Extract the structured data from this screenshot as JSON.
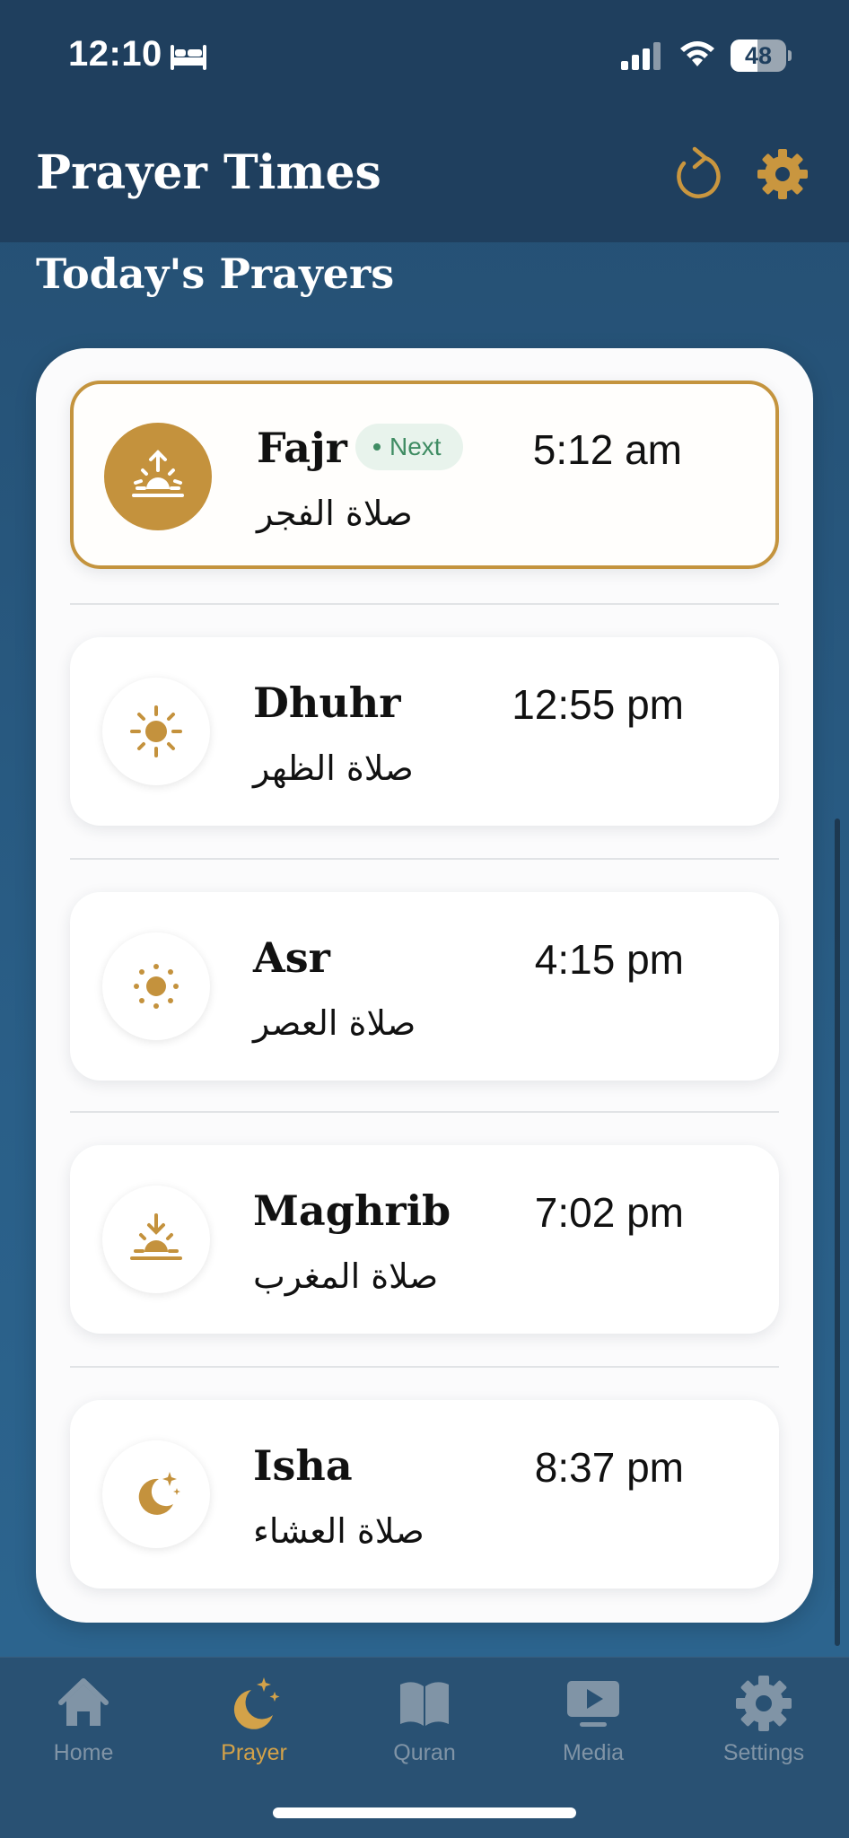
{
  "status_bar": {
    "time": "12:10",
    "battery": "48",
    "battery_level": 0.48,
    "icons": [
      "bed-icon",
      "signal-icon",
      "wifi-icon",
      "battery-icon"
    ]
  },
  "header": {
    "title": "Prayer Times",
    "refresh_icon": "refresh-icon",
    "settings_icon": "gear-icon"
  },
  "section_title": "Today's Prayers",
  "colors": {
    "accent_gold": "#c4923d",
    "header_navy": "#1f3f5e",
    "next_green": "#3f8c63",
    "tab_inactive": "#8094a6"
  },
  "prayers": [
    {
      "name": "Fajr",
      "arabic": "صلاة الفجر",
      "time": "5:12 am",
      "badge": "Next",
      "icon": "sunrise-icon",
      "is_next": true
    },
    {
      "name": "Dhuhr",
      "arabic": "صلاة الظهر",
      "time": "12:55 pm",
      "icon": "sun-icon",
      "is_next": false
    },
    {
      "name": "Asr",
      "arabic": "صلاة العصر",
      "time": "4:15 pm",
      "icon": "sun-small-icon",
      "is_next": false
    },
    {
      "name": "Maghrib",
      "arabic": "صلاة المغرب",
      "time": "7:02 pm",
      "icon": "sunset-icon",
      "is_next": false
    },
    {
      "name": "Isha",
      "arabic": "صلاة العشاء",
      "time": "8:37 pm",
      "icon": "moon-stars-icon",
      "is_next": false
    }
  ],
  "tabs": [
    {
      "label": "Home",
      "icon": "home-icon",
      "active": false
    },
    {
      "label": "Prayer",
      "icon": "moon-stars-icon",
      "active": true
    },
    {
      "label": "Quran",
      "icon": "book-icon",
      "active": false
    },
    {
      "label": "Media",
      "icon": "play-icon",
      "active": false
    },
    {
      "label": "Settings",
      "icon": "gear-icon",
      "active": false
    }
  ]
}
